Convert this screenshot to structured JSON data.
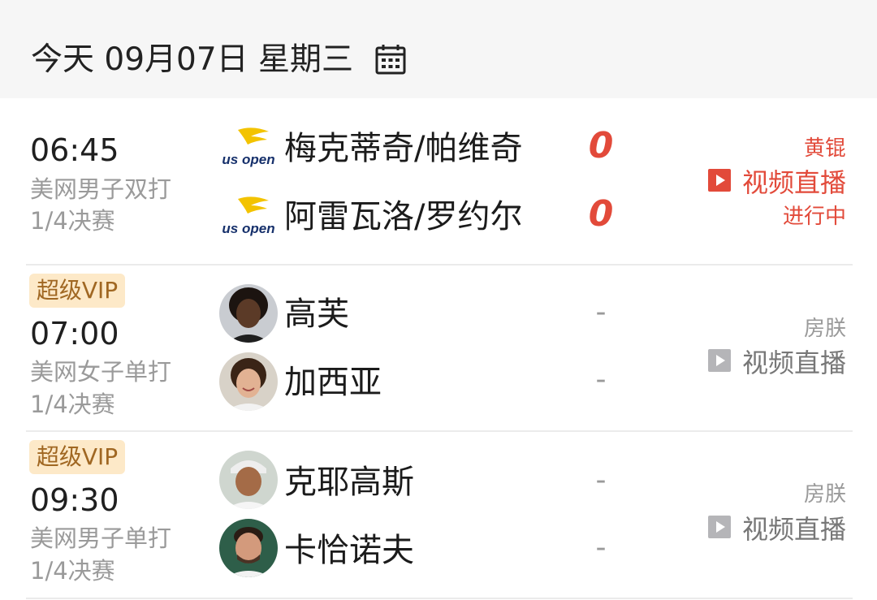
{
  "header": {
    "date_text": "今天 09月07日 星期三",
    "calendar_icon": "calendar-icon"
  },
  "matches": [
    {
      "vip_label": "",
      "time": "06:45",
      "event": "美网男子双打",
      "stage": "1/4决赛",
      "players": [
        {
          "name": "梅克蒂奇/帕维奇",
          "logo_text": "us open",
          "score": "0"
        },
        {
          "name": "阿雷瓦洛/罗约尔",
          "logo_text": "us open",
          "score": "0"
        }
      ],
      "commentator": "黄锟",
      "stream_label": "视频直播",
      "status": "进行中"
    },
    {
      "vip_label": "超级VIP",
      "time": "07:00",
      "event": "美网女子单打",
      "stage": "1/4决赛",
      "players": [
        {
          "name": "高芙",
          "score": "-"
        },
        {
          "name": "加西亚",
          "score": "-"
        }
      ],
      "commentator": "房朕",
      "stream_label": "视频直播",
      "status": ""
    },
    {
      "vip_label": "超级VIP",
      "time": "09:30",
      "event": "美网男子单打",
      "stage": "1/4决赛",
      "players": [
        {
          "name": "克耶高斯",
          "score": "-"
        },
        {
          "name": "卡恰诺夫",
          "score": "-"
        }
      ],
      "commentator": "房朕",
      "stream_label": "视频直播",
      "status": ""
    }
  ],
  "colors": {
    "live_red": "#e24a3a",
    "vip_bg": "#fde9c8",
    "vip_text": "#a06722",
    "muted_text": "#9a9a9a",
    "usopen_yellow": "#f3c300",
    "usopen_blue": "#16306b"
  }
}
